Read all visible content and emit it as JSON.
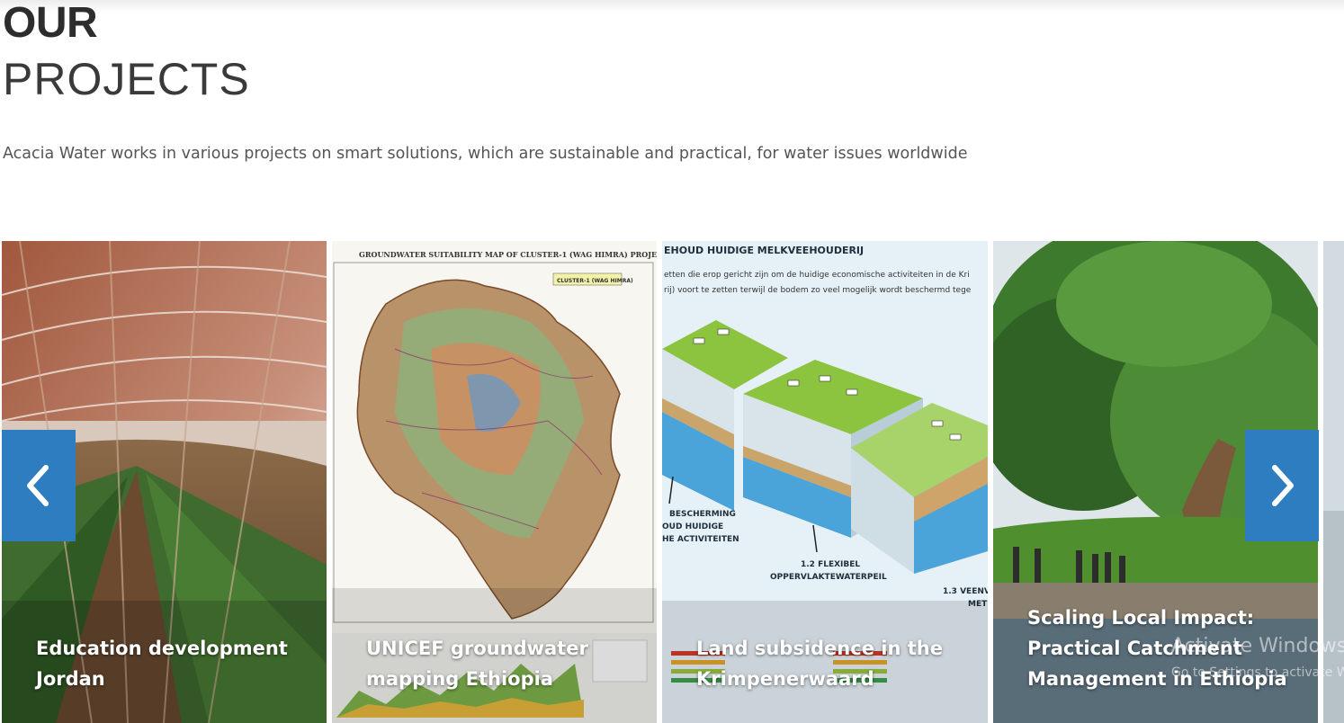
{
  "section": {
    "title_line1": "OUR",
    "title_line2": "PROJECTS",
    "intro": "Acacia Water works in various projects on smart solutions, which are sustainable and practical, for water issues worldwide"
  },
  "carousel": {
    "cards": [
      {
        "title": "Education development Jordan"
      },
      {
        "title": "UNICEF groundwater mapping Ethiopia",
        "image_text": {
          "heading": "GROUNDWATER SUITABILITY MAP OF CLUSTER-1 (WAG HIMRA) PROJECT AREA",
          "legend": "CLUSTER-1 (WAG HIMRA)"
        }
      },
      {
        "title": "Land subsidence in the Krimpenerwaard",
        "image_text": {
          "heading": "EHOUD HUIDIGE MELKVEEHOUDERIJ",
          "line1": "etten die erop gericht zijn om de huidige economische activiteiten in de Kri",
          "line2": "rij) voort te zetten terwijl de bodem zo veel mogelijk wordt beschermd tege",
          "label_a1": "BESCHERMING",
          "label_a2": "OUD HUIDIGE",
          "label_a3": "HE ACTIVITEITEN",
          "label_b1": "1.2 FLEXIBEL",
          "label_b2": "OPPERVLAKTEWATERPEIL",
          "label_c1": "1.3 VEENV",
          "label_c2": "MET"
        }
      },
      {
        "title": "Scaling Local Impact: Practical Catchment Management in Ethiopia"
      }
    ],
    "prev_icon": "chevron-left-icon",
    "next_icon": "chevron-right-icon",
    "accent_color": "#2f7dc1"
  },
  "os_watermark": {
    "line1": "Activate Windows",
    "line2": "Go to Settings to activate Windows."
  }
}
